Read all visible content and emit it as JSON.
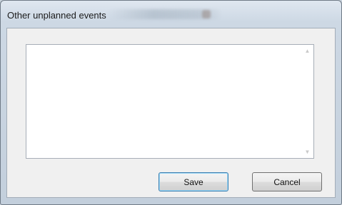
{
  "window": {
    "title": "Other unplanned events"
  },
  "editor": {
    "value": ""
  },
  "buttons": {
    "save_label": "Save",
    "cancel_label": "Cancel"
  },
  "icons": {
    "scroll_up": "triangle-up-icon",
    "scroll_down": "triangle-down-icon"
  },
  "colors": {
    "titlebar": "#dfe7f0",
    "client_bg": "#f0f0f0",
    "default_button_border": "#3c7fb1"
  }
}
